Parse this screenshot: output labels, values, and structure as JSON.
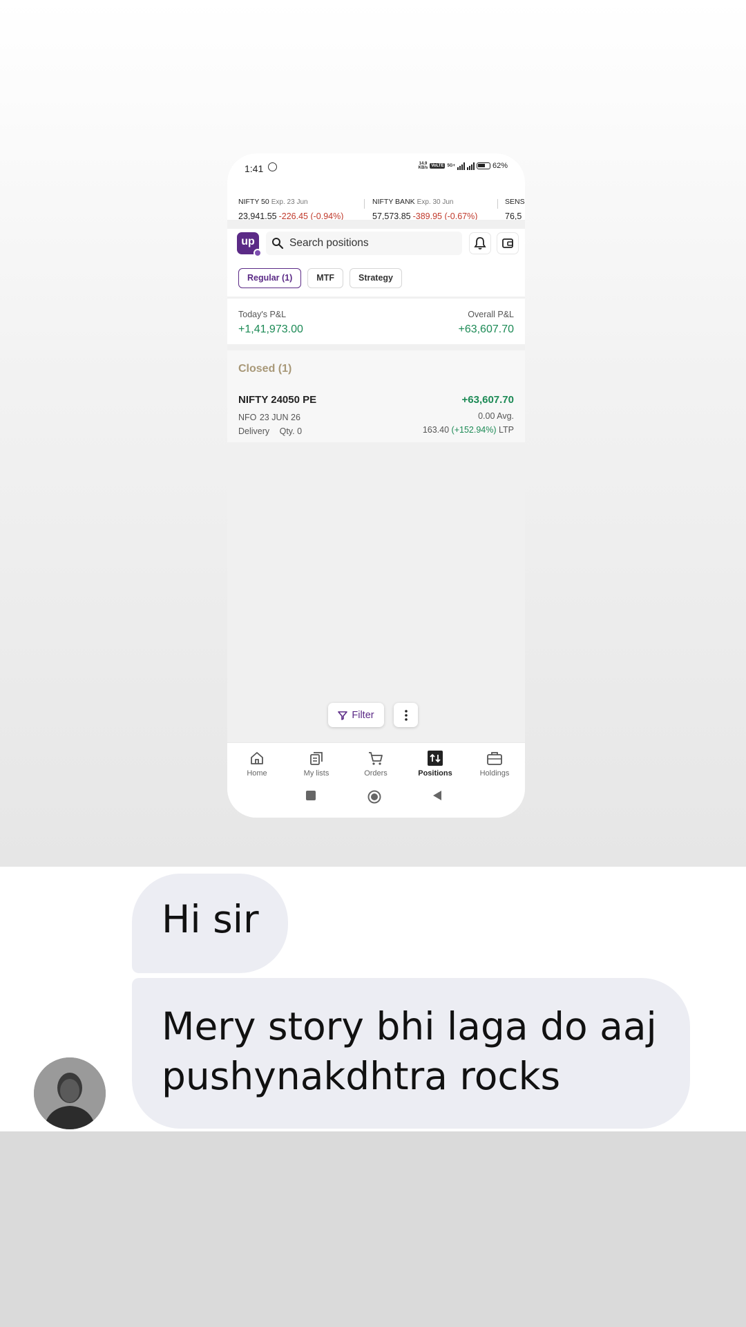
{
  "status_bar": {
    "time": "1:41",
    "speed_top": "14.9",
    "speed_bottom": "KB/s",
    "network": "5G+",
    "volte": "VoLTE",
    "battery": "62%"
  },
  "ticker": [
    {
      "name": "NIFTY 50",
      "expiry": "Exp. 23 Jun",
      "price": "23,941.55",
      "change": "-226.45 (-0.94%)"
    },
    {
      "name": "NIFTY BANK",
      "expiry": "Exp. 30 Jun",
      "price": "57,573.85",
      "change": "-389.95 (-0.67%)"
    },
    {
      "name": "SENS",
      "price": "76,5"
    }
  ],
  "header": {
    "logo_text": "up",
    "search_placeholder": "Search positions"
  },
  "tabs": [
    {
      "label": "Regular (1)",
      "active": true
    },
    {
      "label": "MTF",
      "active": false
    },
    {
      "label": "Strategy",
      "active": false
    }
  ],
  "pnl": {
    "today_label": "Today's P&L",
    "today_value": "+1,41,973.00",
    "overall_label": "Overall P&L",
    "overall_value": "+63,607.70"
  },
  "closed": {
    "title": "Closed (1)",
    "positions": [
      {
        "name": "NIFTY 24050 PE",
        "pnl": "+63,607.70",
        "exchange": "NFO",
        "expiry": "23 JUN 26",
        "avg": "0.00 Avg.",
        "type": "Delivery",
        "qty": "Qty. 0",
        "ltp": "163.40",
        "ltp_change": "(+152.94%)",
        "ltp_label": "LTP"
      }
    ]
  },
  "actions": {
    "filter_label": "Filter"
  },
  "bottom_nav": [
    {
      "label": "Home",
      "icon": "home-icon",
      "active": false
    },
    {
      "label": "My lists",
      "icon": "lists-icon",
      "active": false
    },
    {
      "label": "Orders",
      "icon": "cart-icon",
      "active": false
    },
    {
      "label": "Positions",
      "icon": "positions-icon",
      "active": true
    },
    {
      "label": "Holdings",
      "icon": "briefcase-icon",
      "active": false
    }
  ],
  "chat": {
    "messages": [
      "Hi sir",
      "Mery story bhi laga do aaj pushynakdhtra rocks"
    ]
  },
  "colors": {
    "brand": "#5b2a86",
    "profit": "#1c8a55",
    "loss": "#c0392b",
    "closed_title": "#a89878",
    "bubble": "#ecedf3"
  }
}
